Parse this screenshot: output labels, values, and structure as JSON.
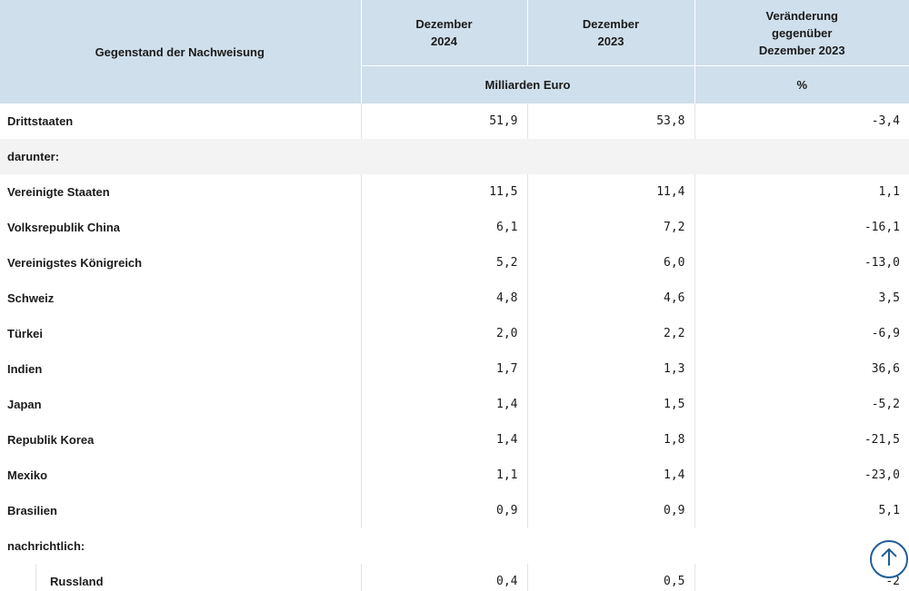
{
  "table": {
    "header": {
      "subject": "Gegenstand der Nachweisung",
      "col1": {
        "line1": "Dezember",
        "line2": "2024"
      },
      "col2": {
        "line1": "Dezember",
        "line2": "2023"
      },
      "col3": {
        "line1": "Veränderung",
        "line2": "gegenüber",
        "line3": "Dezember 2023"
      },
      "unit_values": "Milliarden Euro",
      "unit_change": "%"
    },
    "rows": [
      {
        "label": "Drittstaaten",
        "v2024": "51,9",
        "v2023": "53,8",
        "change": "-3,4"
      },
      {
        "label": "darunter:"
      },
      {
        "label": "Vereinigte Staaten",
        "v2024": "11,5",
        "v2023": "11,4",
        "change": "1,1"
      },
      {
        "label": "Volksrepublik China",
        "v2024": "6,1",
        "v2023": "7,2",
        "change": "-16,1"
      },
      {
        "label": "Vereinigstes Königreich",
        "v2024": "5,2",
        "v2023": "6,0",
        "change": "-13,0"
      },
      {
        "label": "Schweiz",
        "v2024": "4,8",
        "v2023": "4,6",
        "change": "3,5"
      },
      {
        "label": "Türkei",
        "v2024": "2,0",
        "v2023": "2,2",
        "change": "-6,9"
      },
      {
        "label": "Indien",
        "v2024": "1,7",
        "v2023": "1,3",
        "change": "36,6"
      },
      {
        "label": "Japan",
        "v2024": "1,4",
        "v2023": "1,5",
        "change": "-5,2"
      },
      {
        "label": "Republik Korea",
        "v2024": "1,4",
        "v2023": "1,8",
        "change": "-21,5"
      },
      {
        "label": "Mexiko",
        "v2024": "1,1",
        "v2023": "1,4",
        "change": "-23,0"
      },
      {
        "label": "Brasilien",
        "v2024": "0,9",
        "v2023": "0,9",
        "change": "5,1"
      },
      {
        "label": "nachrichtlich:"
      },
      {
        "label": "Russland",
        "v2024": "0,4",
        "v2023": "0,5",
        "change": "-2"
      }
    ]
  },
  "scroll_top_icon": "arrow-up-icon",
  "colors": {
    "header_bg": "#cfdfec",
    "accent": "#1f5e97",
    "row_shade": "#f3f3f3"
  }
}
